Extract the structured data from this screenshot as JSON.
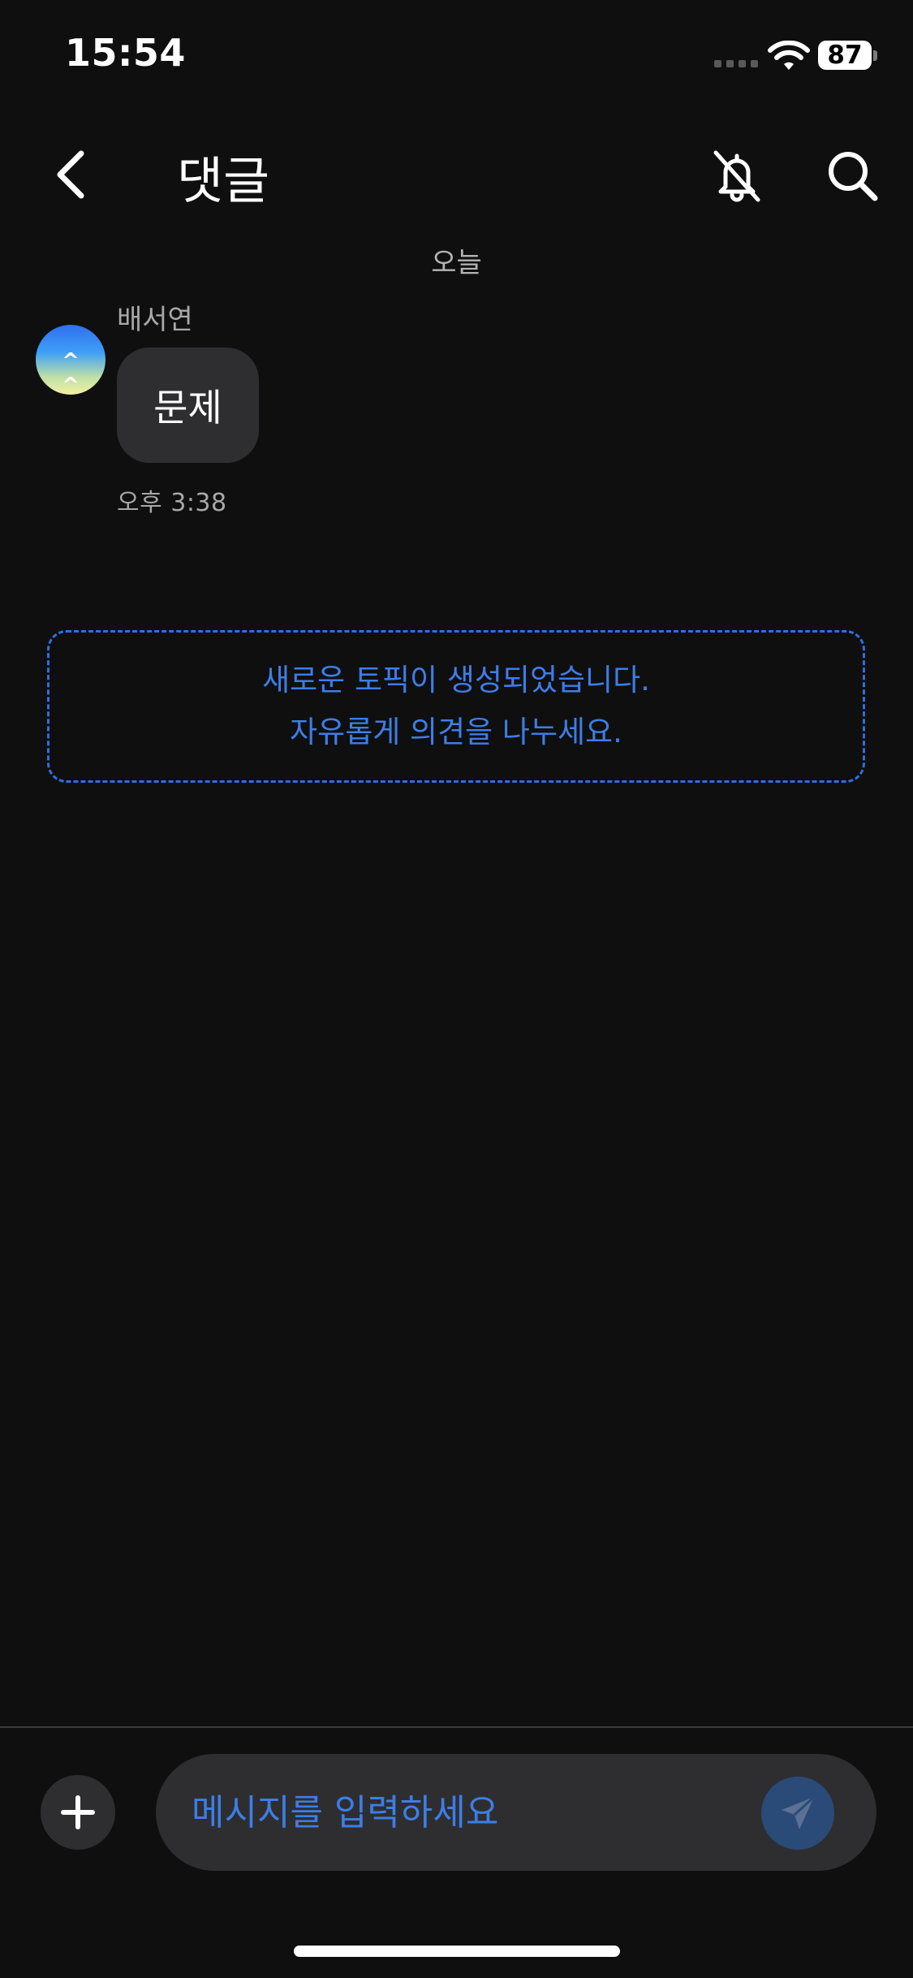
{
  "status_bar": {
    "time": "15:54",
    "battery": "87",
    "icons": [
      "signal-icon",
      "wifi-icon",
      "battery-icon"
    ]
  },
  "header": {
    "title": "댓글",
    "icons": [
      "back-chevron-icon",
      "bell-slash-icon",
      "search-icon"
    ]
  },
  "conversation": {
    "date_label": "오늘",
    "messages": [
      {
        "sender": "배서연",
        "avatar_face": "^ ^",
        "text": "문제",
        "time": "오후 3:38"
      }
    ]
  },
  "notice": {
    "line1": "새로운 토픽이 생성되었습니다.",
    "line2": "자유롭게 의견을 나누세요."
  },
  "composer": {
    "placeholder": "메시지를 입력하세요",
    "icons": [
      "plus-icon",
      "send-icon"
    ]
  },
  "colors": {
    "background": "#0f0f10",
    "bubble": "#2e2e30",
    "accent_blue": "#3d7ee6",
    "send_button": "#2a4a78"
  }
}
